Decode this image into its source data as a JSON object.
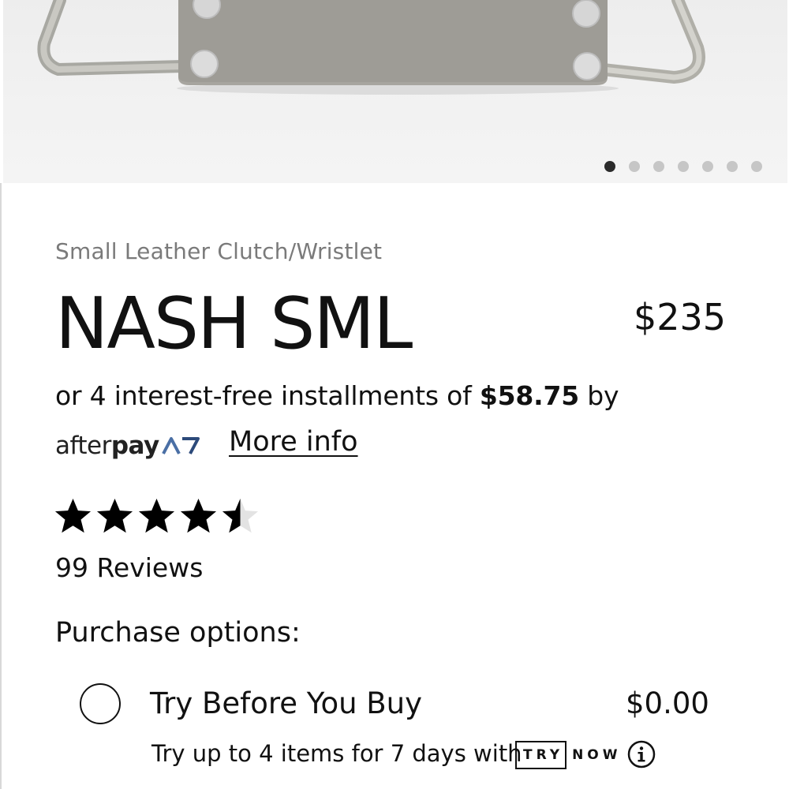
{
  "gallery": {
    "dot_count": 7,
    "active_index": 0
  },
  "product": {
    "category": "Small Leather Clutch/Wristlet",
    "name": "NASH SML",
    "price": "$235"
  },
  "afterpay": {
    "installments_prefix": "or 4 interest-free installments of ",
    "installment_amount": "$58.75",
    "installments_suffix": " by",
    "logo_text_regular": "after",
    "logo_text_bold": "pay",
    "more_info": "More info"
  },
  "rating": {
    "stars": 4.5,
    "max": 5,
    "reviews_label": "99 Reviews"
  },
  "purchase": {
    "label": "Purchase options:",
    "options": [
      {
        "label": "Try Before You Buy",
        "price": "$0.00",
        "selected": false,
        "description": "Try up to 4 items for 7 days with",
        "badge_boxed": "TRY",
        "badge_plain": "NOW"
      }
    ]
  },
  "colors": {
    "text": "#111111",
    "muted": "#7a7a7a",
    "dot_active": "#2b2b2b",
    "dot_inactive": "#c6c6c6"
  }
}
